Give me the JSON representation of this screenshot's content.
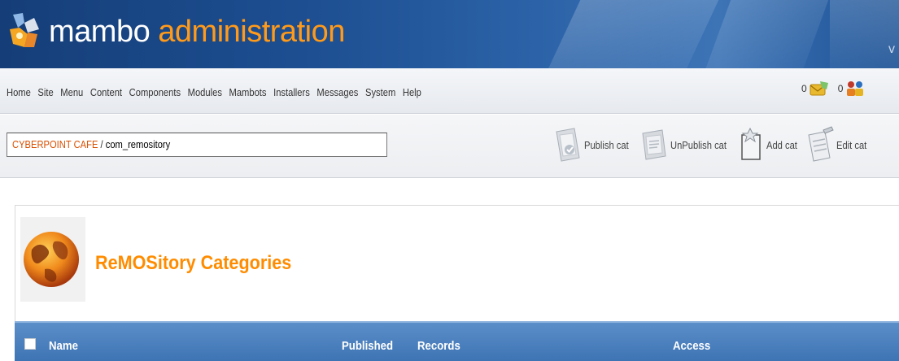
{
  "header": {
    "logo_word1": "mambo",
    "logo_word2": "administration",
    "corner_letter": "v"
  },
  "menu": {
    "items": [
      "Home",
      "Site",
      "Menu",
      "Content",
      "Components",
      "Modules",
      "Mambots",
      "Installers",
      "Messages",
      "System",
      "Help"
    ],
    "messages_count": "0",
    "users_online_count": "0"
  },
  "pathway": {
    "site_name": "CYBERPOINT CAFE",
    "separator": " / ",
    "component": "com_remository"
  },
  "toolbar": {
    "publish_label": "Publish cat",
    "unpublish_label": "UnPublish cat",
    "add_label": "Add cat",
    "edit_label": "Edit cat"
  },
  "page": {
    "title": "ReMOSitory Categories"
  },
  "table": {
    "columns": [
      "Name",
      "Published",
      "Records",
      "Access"
    ]
  },
  "colors": {
    "header_blue": "#1d4f92",
    "logo_orange": "#ff9a1a",
    "title_orange": "#ff8c00",
    "pathway_site": "#d94f00",
    "table_header": "#4a80bf"
  }
}
